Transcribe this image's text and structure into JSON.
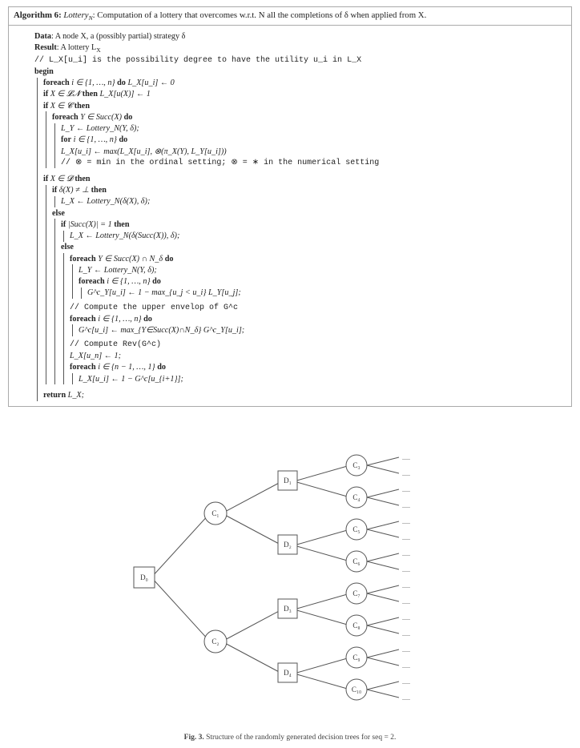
{
  "algorithm": {
    "number": "6",
    "title_prefix": "Algorithm 6:",
    "title_name": "Lottery",
    "title_sub": "N",
    "title_rest": ": Computation of a lottery that overcomes w.r.t. N all the completions of δ when applied from X.",
    "data_label": "Data",
    "data_text": ": A node X, a (possibly partial) strategy δ",
    "result_label": "Result",
    "result_text": ": A lottery L",
    "result_sub": "X",
    "comment1": "// L_X[u_i] is the possibility degree to have the utility u_i in L_X",
    "begin": "begin",
    "l_foreach1_a": "foreach",
    "l_foreach1_b": " i ∈ {1, …, n} ",
    "l_foreach1_c": "do",
    "l_foreach1_d": " L_X[u_i] ← 0",
    "l_if1_a": "if",
    "l_if1_b": " X ∈ 𝓛𝓝 ",
    "l_if1_c": "then",
    "l_if1_d": " L_X[u(X)] ← 1",
    "l_if2_a": "if",
    "l_if2_b": " X ∈ 𝓒 ",
    "l_if2_c": "then",
    "l_foreach2_a": "foreach",
    "l_foreach2_b": " Y ∈ Succ(X) ",
    "l_foreach2_c": "do",
    "l_assign1": "L_Y ← Lottery_N(Y, δ);",
    "l_for1_a": "for",
    "l_for1_b": " i ∈ {1, …, n} ",
    "l_for1_c": "do",
    "l_assign2": "L_X[u_i] ← max(L_X[u_i], ⊗(π_X(Y), L_Y[u_i]))",
    "comment2": "// ⊗ = min in the ordinal setting; ⊗ = ∗ in the numerical setting",
    "l_if3_a": "if",
    "l_if3_b": " X ∈ 𝓓 ",
    "l_if3_c": "then",
    "l_if4_a": "if",
    "l_if4_b": " δ(X) ≠ ⊥ ",
    "l_if4_c": "then",
    "l_assign3": "L_X ← Lottery_N(δ(X), δ);",
    "l_else1": "else",
    "l_if5_a": "if",
    "l_if5_b": " |Succ(X)| = 1 ",
    "l_if5_c": "then",
    "l_assign4": "L_X ← Lottery_N(δ(Succ(X)), δ);",
    "l_else2": "else",
    "l_foreach3_a": "foreach",
    "l_foreach3_b": " Y ∈ Succ(X) ∩ N_δ ",
    "l_foreach3_c": "do",
    "l_assign5": "L_Y ← Lottery_N(Y, δ);",
    "l_foreach4_a": "foreach",
    "l_foreach4_b": " i ∈ {1, …, n} ",
    "l_foreach4_c": "do",
    "l_assign6": "G^c_Y[u_i] ← 1 − max_{u_j < u_i} L_Y[u_j];",
    "comment3": "// Compute the upper envelop of G^c",
    "l_foreach5_a": "foreach",
    "l_foreach5_b": " i ∈ {1, …, n} ",
    "l_foreach5_c": "do",
    "l_assign7": "G^c[u_i] ← max_{Y∈Succ(X)∩N_δ} G^c_Y[u_i];",
    "comment4": "// Compute Rev(G^c)",
    "l_assign8": "L_X[u_n] ← 1;",
    "l_foreach6_a": "foreach",
    "l_foreach6_b": " i ∈ {n − 1, …, 1} ",
    "l_foreach6_c": "do",
    "l_assign9": "L_X[u_i] ← 1 − G^c[u_{i+1}];",
    "l_return_a": "return",
    "l_return_b": " L_X;"
  },
  "figure": {
    "nodes": {
      "D0": "D₀",
      "C1": "C₁",
      "C2": "C₂",
      "D1": "D₁",
      "D2": "D₂",
      "D3": "D₃",
      "D4": "D₄",
      "C3": "C₃",
      "C4": "C₄",
      "C5": "C₅",
      "C6": "C₆",
      "C7": "C₇",
      "C8": "C₈",
      "C9": "C₉",
      "C10": "C₁₀"
    },
    "dots": ".....",
    "caption_prefix": "Fig. 3.",
    "caption_text": " Structure of the randomly generated decision trees for seq = 2."
  }
}
